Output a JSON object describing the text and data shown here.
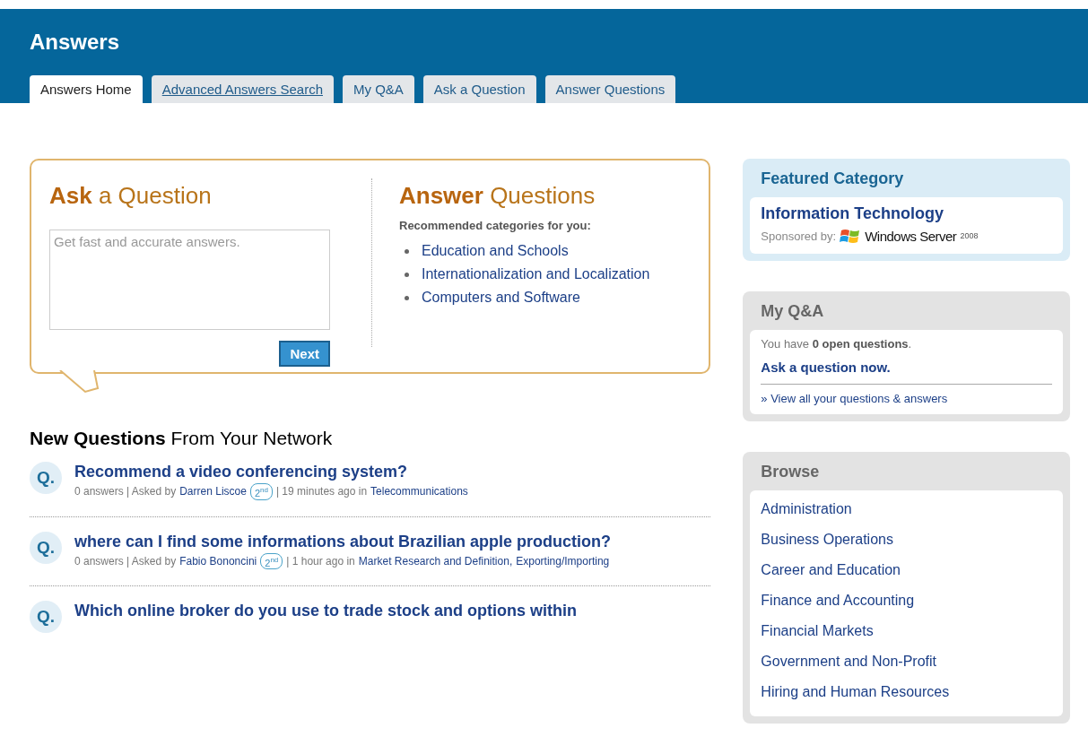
{
  "header": {
    "title": "Answers"
  },
  "tabs": [
    {
      "label": "Answers Home",
      "selected": true,
      "link": false
    },
    {
      "label": "Advanced Answers Search",
      "selected": false,
      "link": true
    },
    {
      "label": "My Q&A",
      "selected": false,
      "link": false
    },
    {
      "label": "Ask a Question",
      "selected": false,
      "link": false
    },
    {
      "label": "Answer Questions",
      "selected": false,
      "link": false
    }
  ],
  "ask": {
    "heading": "**Ask** a Question",
    "placeholder": "Get fast and accurate answers.",
    "button": "Next"
  },
  "answer": {
    "heading": "**Answer** Questions",
    "subheading": "Recommended categories for you:",
    "categories": [
      "Education and Schools",
      "Internationalization and Localization",
      "Computers and Software"
    ]
  },
  "new_questions": {
    "heading": "**New Questions** From Your Network",
    "items": [
      {
        "mark": "Q.",
        "title": "Recommend a video conferencing system?",
        "prefix": "0 answers | Asked by",
        "asker": "Darren Liscoe",
        "degree": "2$^{nd}$",
        "suffix": "| 19 minutes ago in",
        "categories": [
          "Telecommunications"
        ]
      },
      {
        "mark": "Q.",
        "title": "where can I find some informations about Brazilian apple production?",
        "prefix": "0 answers | Asked by",
        "asker": "Fabio Bononcini",
        "degree": "2$^{nd}$",
        "suffix": "| 1 hour ago in",
        "categories": [
          "Market Research and Definition,",
          "Exporting/Importing"
        ]
      },
      {
        "mark": "Q.",
        "title": "Which online broker do you use to trade stock and options within"
      }
    ]
  },
  "featured": {
    "heading": "Featured Category",
    "category": "Information Technology",
    "sponsored_by": "Sponsored by:",
    "sponsor": "Windows Server",
    "sponsor_year": "2008"
  },
  "my_qa": {
    "heading": "My Q&A",
    "status": "You have **0 open questions**.",
    "ask_link": "Ask a question now.",
    "view_link": "» View all your questions & answers"
  },
  "browse": {
    "heading": "Browse",
    "items": [
      "Administration",
      "Business Operations",
      "Career and Education",
      "Finance and Accounting",
      "Financial Markets",
      "Government and Non-Profit",
      "Hiring and Human Resources"
    ]
  }
}
